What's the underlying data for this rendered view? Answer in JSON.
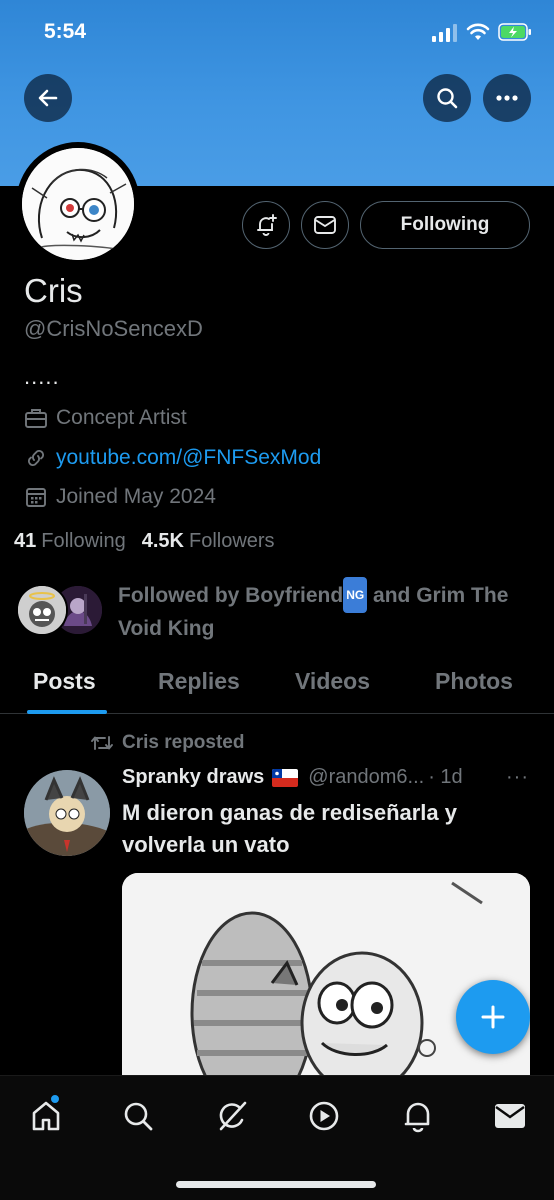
{
  "status_bar": {
    "time": "5:54"
  },
  "profile": {
    "name": "Cris",
    "handle": "@CrisNoSencexD",
    "bio": ".....",
    "job": "Concept Artist",
    "link": "youtube.com/@FNFSexMod",
    "joined": "Joined May 2024",
    "following_count": "41",
    "following_label": "Following",
    "followers_count": "4.5K",
    "followers_label": "Followers",
    "following_button": "Following",
    "followed_by_prefix": "Followed by Boyfriend",
    "followed_by_badge": "NG",
    "followed_by_suffix": " and Grim The Void King"
  },
  "tabs": [
    {
      "label": "Posts",
      "active": true
    },
    {
      "label": "Replies",
      "active": false
    },
    {
      "label": "Videos",
      "active": false
    },
    {
      "label": "Photos",
      "active": false
    }
  ],
  "post": {
    "repost_label": "Cris reposted",
    "author": "Spranky draws",
    "handle": "@random6...",
    "time": "· 1d",
    "more": "···",
    "text": "M dieron ganas de rediseñarla y volverla un vato"
  },
  "nav": {
    "items": [
      "home-icon",
      "search-icon",
      "grok-icon",
      "video-icon",
      "notifications-icon",
      "messages-icon"
    ]
  },
  "colors": {
    "accent": "#1d9bf0",
    "banner": "#3f95e2",
    "muted": "#71767b"
  }
}
